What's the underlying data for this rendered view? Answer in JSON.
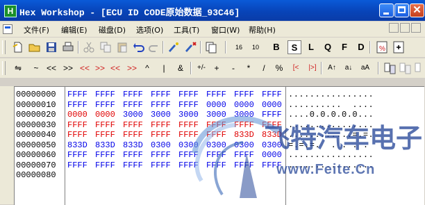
{
  "window": {
    "app_icon_letter": "H",
    "title": "Hex Workshop - [ECU ID CODE原始数据_93C46]"
  },
  "menu": {
    "items": [
      "文件(F)",
      "编辑(E)",
      "磁盘(D)",
      "选项(O)",
      "工具(T)",
      "窗口(W)",
      "帮助(H)"
    ]
  },
  "toolbar1": {
    "labels": [
      "16",
      "10",
      "B",
      "S",
      "L",
      "Q",
      "F",
      "D"
    ]
  },
  "toolbar2": {
    "labels": [
      "⇋",
      "~",
      "<<",
      ">>",
      "<<",
      ">>",
      "<<",
      ">>",
      "^",
      "|",
      "&",
      "+/-",
      "+",
      "-",
      "*",
      "/",
      "%",
      "[<",
      "|>]",
      "A↑",
      "a↓",
      "aA"
    ]
  },
  "hex": {
    "addresses": [
      "00000000",
      "00000010",
      "00000020",
      "00000030",
      "00000040",
      "00000050",
      "00000060",
      "00000070",
      "00000080"
    ],
    "rows": [
      [
        "FFFF",
        "FFFF",
        "FFFF",
        "FFFF",
        "FFFF",
        "FFFF",
        "FFFF",
        "FFFF"
      ],
      [
        "FFFF",
        "FFFF",
        "FFFF",
        "FFFF",
        "FFFF",
        "0000",
        "0000",
        "0000"
      ],
      [
        "0000",
        "0000",
        "3000",
        "3000",
        "3000",
        "3000",
        "3000",
        "FFFF"
      ],
      [
        "FFFF",
        "FFFF",
        "FFFF",
        "FFFF",
        "FFFF",
        "FFFF",
        "FFFF",
        "FFFF"
      ],
      [
        "FFFF",
        "FFFF",
        "FFFF",
        "FFFF",
        "FFFF",
        "FFFF",
        "833D",
        "833D"
      ],
      [
        "833D",
        "833D",
        "833D",
        "0300",
        "0300",
        "0300",
        "0300",
        "0300"
      ],
      [
        "FFFF",
        "FFFF",
        "FFFF",
        "FFFF",
        "FFFF",
        "FFFF",
        "FFFF",
        "0000"
      ],
      [
        "FFFF",
        "FFFF",
        "FFFF",
        "FFFF",
        "FFFF",
        "FFFF",
        "FFFF",
        "FFFF"
      ],
      []
    ],
    "row_colors": [
      "blue",
      "blue",
      "mixed",
      "red",
      "red",
      "blue",
      "blue",
      "blue",
      "blue"
    ],
    "ascii": [
      "................",
      "..........  ....",
      "....0.0.0.0.0...",
      "................",
      "............=.=.",
      "=.=.=.  . . . . ",
      "................",
      "................",
      ""
    ]
  },
  "watermark": {
    "cn": "飞特汽车电子",
    "url": "www.Feite.Cn"
  },
  "colors": {
    "title_bar": "#0a4cc0",
    "hex_blue": "#0000e8",
    "hex_red": "#e00000",
    "watermark": "#2a4a9a"
  }
}
